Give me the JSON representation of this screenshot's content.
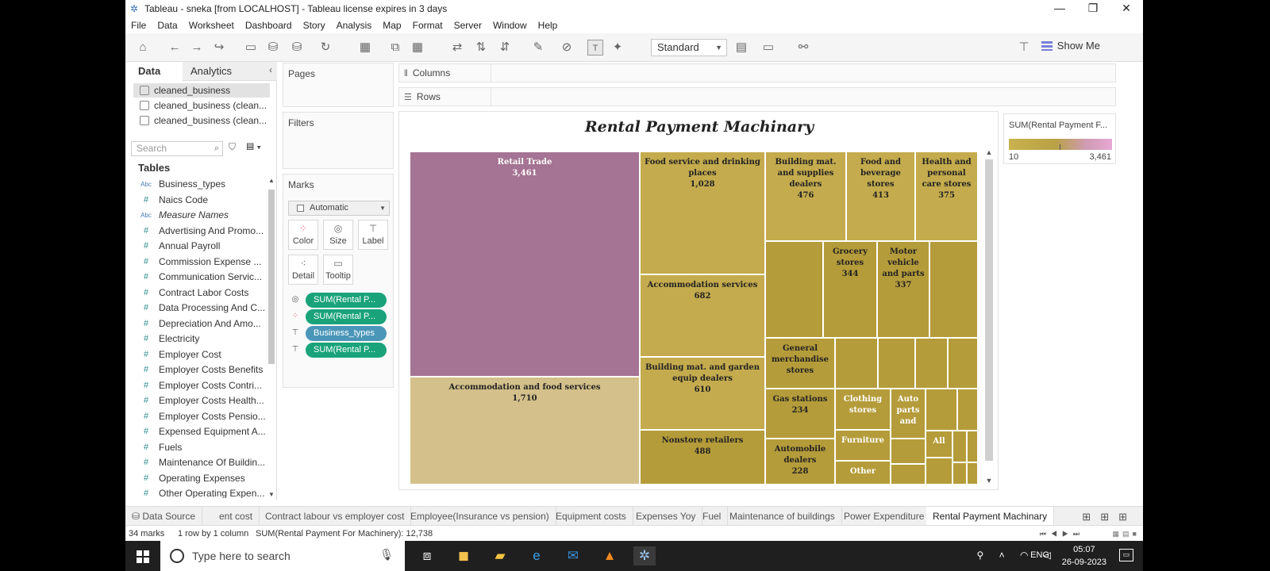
{
  "window": {
    "title": "Tableau - sneka [from LOCALHOST] - Tableau license expires in 3 days",
    "min": "—",
    "max": "❐",
    "close": "✕"
  },
  "menu": [
    "File",
    "Data",
    "Worksheet",
    "Dashboard",
    "Story",
    "Analysis",
    "Map",
    "Format",
    "Server",
    "Window",
    "Help"
  ],
  "toolbar": {
    "fit_value": "Standard",
    "show_me": "Show Me"
  },
  "datapane": {
    "tab_data": "Data",
    "tab_analytics": "Analytics",
    "datasources": [
      "cleaned_business",
      "cleaned_business (clean...",
      "cleaned_business (clean..."
    ],
    "search_placeholder": "Search",
    "tables_heading": "Tables",
    "fields": [
      {
        "type": "Abc",
        "name": "Business_types"
      },
      {
        "type": "#",
        "name": "Naics Code"
      },
      {
        "type": "Abc",
        "name": "Measure Names"
      },
      {
        "type": "#",
        "name": "Advertising And Promo..."
      },
      {
        "type": "#",
        "name": "Annual Payroll"
      },
      {
        "type": "#",
        "name": "Commission Expense ..."
      },
      {
        "type": "#",
        "name": "Communication Servic..."
      },
      {
        "type": "#",
        "name": "Contract Labor Costs"
      },
      {
        "type": "#",
        "name": "Data Processing And C..."
      },
      {
        "type": "#",
        "name": "Depreciation And Amo..."
      },
      {
        "type": "#",
        "name": "Electricity"
      },
      {
        "type": "#",
        "name": "Employer Cost"
      },
      {
        "type": "#",
        "name": "Employer Costs Benefits"
      },
      {
        "type": "#",
        "name": "Employer Costs Contri..."
      },
      {
        "type": "#",
        "name": "Employer Costs Health..."
      },
      {
        "type": "#",
        "name": "Employer Costs Pensio..."
      },
      {
        "type": "#",
        "name": "Expensed Equipment A..."
      },
      {
        "type": "#",
        "name": "Fuels"
      },
      {
        "type": "#",
        "name": "Maintenance Of Buildin..."
      },
      {
        "type": "#",
        "name": "Operating Expenses"
      },
      {
        "type": "#",
        "name": "Other Operating Expen..."
      }
    ]
  },
  "cards": {
    "pages": "Pages",
    "filters": "Filters",
    "marks": "Marks",
    "mark_type": "Automatic",
    "buttons": [
      "Color",
      "Size",
      "Label",
      "Detail",
      "Tooltip"
    ],
    "pills": [
      {
        "icon": "size-icon",
        "label": "SUM(Rental P...",
        "color": "#1aa37a"
      },
      {
        "icon": "color-icon",
        "label": "SUM(Rental P...",
        "color": "#1aa37a"
      },
      {
        "icon": "label-icon",
        "label": "Business_types",
        "color": "#4a96b8"
      },
      {
        "icon": "label-icon",
        "label": "SUM(Rental P...",
        "color": "#1aa37a"
      }
    ]
  },
  "shelves": {
    "columns": "Columns",
    "rows": "Rows"
  },
  "viz": {
    "title": "Rental Payment Machinary"
  },
  "legend": {
    "title": "SUM(Rental Payment F...",
    "min": "10",
    "max": "3,461"
  },
  "chart_data": {
    "type": "treemap",
    "title": "Rental Payment Machinary",
    "measure": "SUM(Rental Payment For Machinery)",
    "items": [
      {
        "label": "Retail Trade",
        "value": "3,461"
      },
      {
        "label": "Accommodation and food services",
        "value": "1,710"
      },
      {
        "label": "Food service and drinking places",
        "value": "1,028"
      },
      {
        "label": "Accommodation services",
        "value": "682"
      },
      {
        "label": "Building mat. and garden equip dealers",
        "value": "610"
      },
      {
        "label": "Nonstore retailers",
        "value": "488"
      },
      {
        "label": "Building mat. and supplies dealers",
        "value": "476"
      },
      {
        "label": "Food and beverage stores",
        "value": "413"
      },
      {
        "label": "Health and personal care stores",
        "value": "375"
      },
      {
        "label": "Grocery stores",
        "value": "344"
      },
      {
        "label": "Motor vehicle and parts",
        "value": "337"
      },
      {
        "label": "General merchandise stores",
        "value": ""
      },
      {
        "label": "Gas stations",
        "value": "234"
      },
      {
        "label": "Automobile dealers",
        "value": "228"
      },
      {
        "label": "Clothing stores",
        "value": ""
      },
      {
        "label": "Auto parts and",
        "value": ""
      },
      {
        "label": "Furniture",
        "value": ""
      },
      {
        "label": "All",
        "value": ""
      },
      {
        "label": "Other",
        "value": ""
      }
    ]
  },
  "sheet_tabs": [
    "Data Source",
    "ent cost",
    "Contract labour vs employer cost",
    "Employee(Insurance vs pension)",
    "Equipment costs",
    "Expenses Yoy",
    "Fuel",
    "Maintenance of buildings",
    "Power Expenditure",
    "Rental Payment Machinary"
  ],
  "status": {
    "marks": "34 marks",
    "rows": "1 row by 1 column",
    "sum": "SUM(Rental Payment For Machinery): 12,738"
  },
  "taskbar": {
    "search": "Type here to search",
    "lang": "ENG",
    "time": "05:07",
    "date": "26-09-2023"
  },
  "colors": {
    "retail": "#a57393",
    "accommodation_food": "#d3c08a",
    "mid_olive": "#c4ab4d",
    "dark_olive": "#b59c3a",
    "pill_green": "#1aa37a",
    "pill_blue": "#4a96b8"
  }
}
